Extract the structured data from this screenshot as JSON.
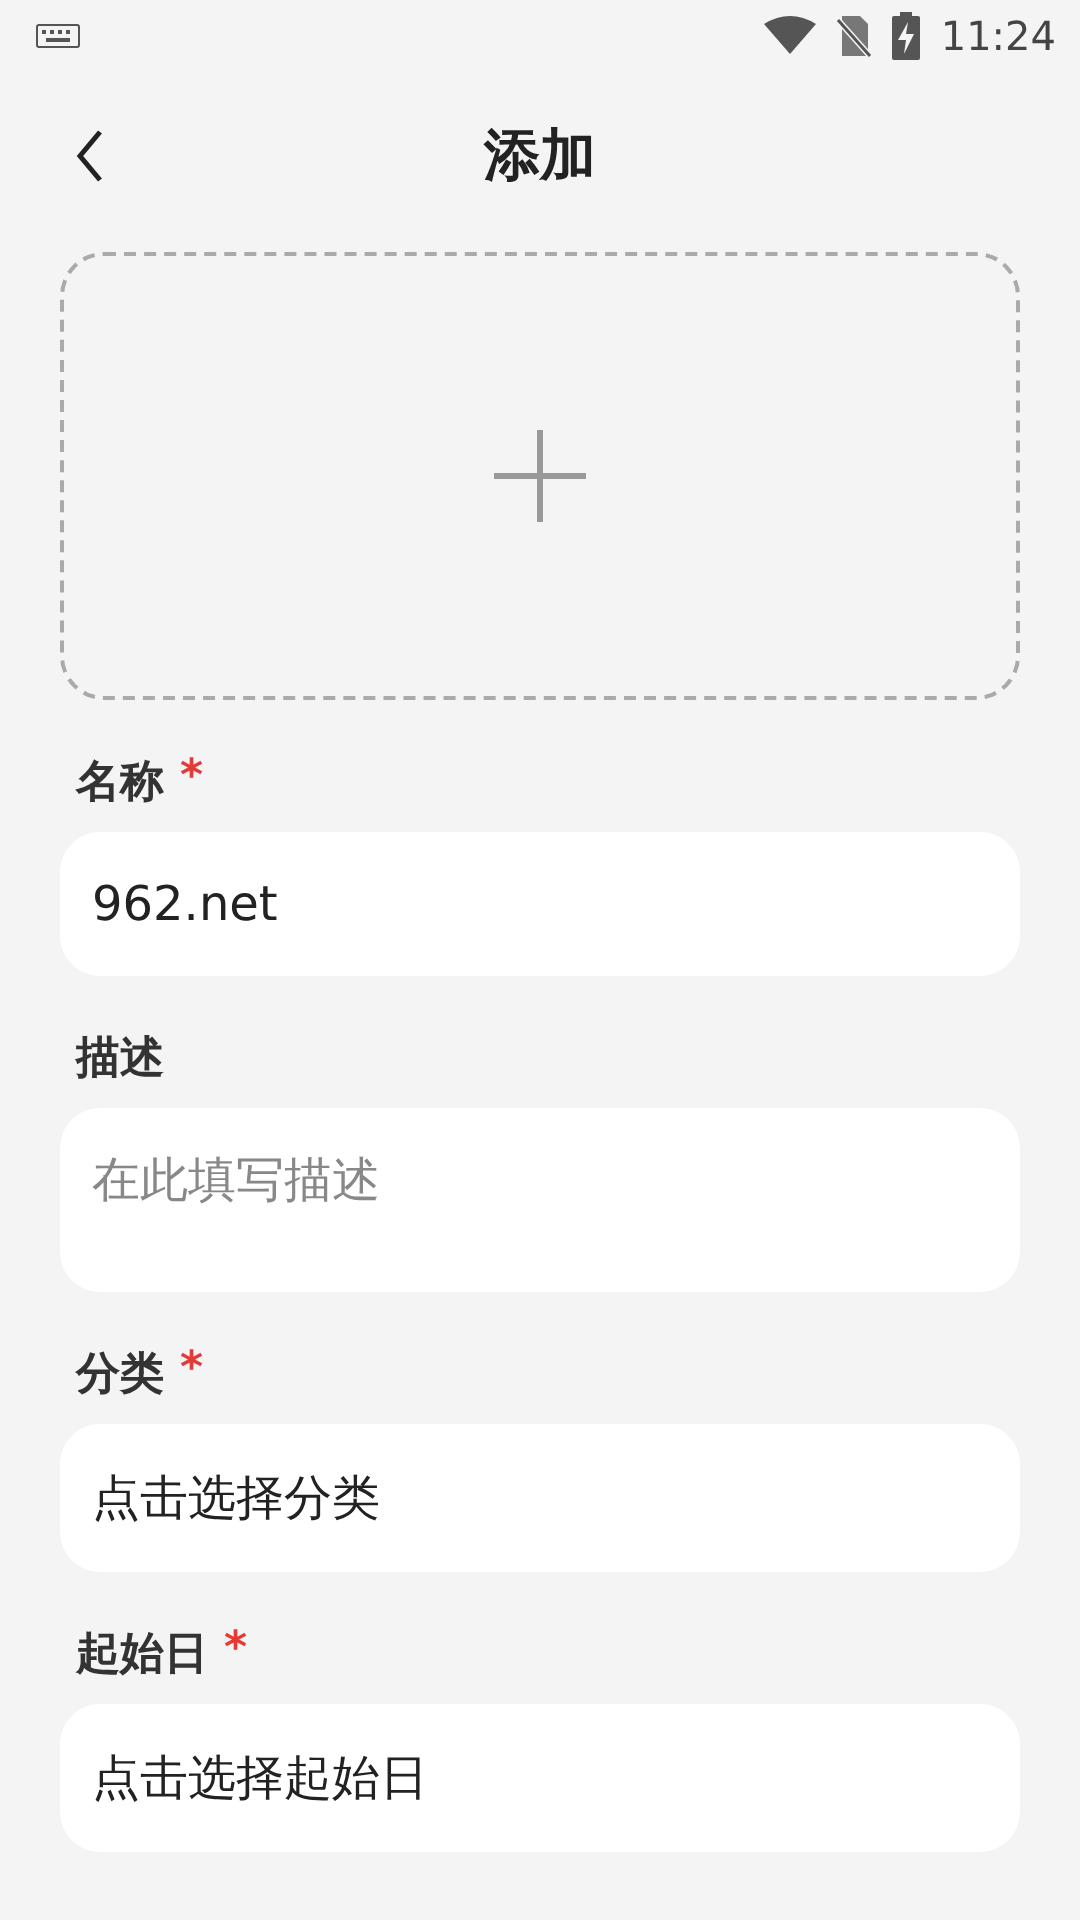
{
  "status_bar": {
    "time": "11:24"
  },
  "header": {
    "title": "添加"
  },
  "image_upload": {
    "kind": "picture-slot"
  },
  "fields": [
    {
      "label": "名称",
      "required_mark": "*",
      "kind": "input",
      "value": "962.net"
    },
    {
      "label": "描述",
      "kind": "textarea",
      "placeholder": "在此填写描述"
    },
    {
      "label": "分类",
      "required_mark": "*",
      "kind": "select",
      "text": "点击选择分类"
    },
    {
      "label": "起始日",
      "required_mark": "*",
      "kind": "select",
      "text": "点击选择起始日"
    }
  ]
}
